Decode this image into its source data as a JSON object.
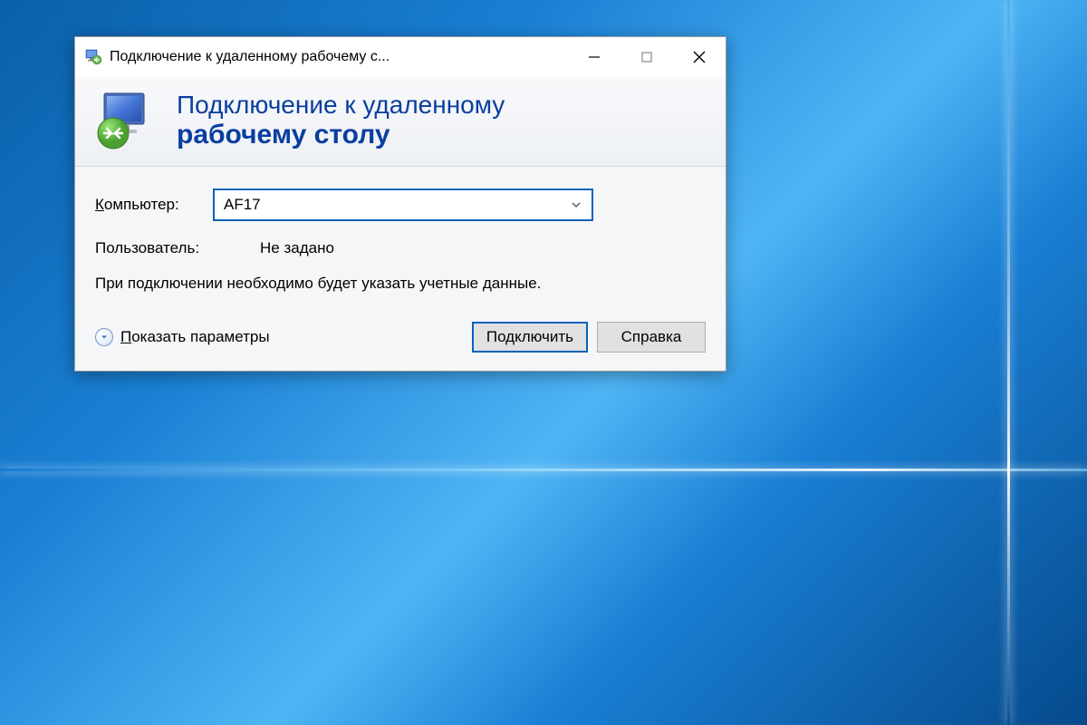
{
  "window": {
    "title": "Подключение к удаленному рабочему с..."
  },
  "banner": {
    "line1": "Подключение к удаленному",
    "line2": "рабочему столу"
  },
  "form": {
    "computer_label": "Компьютер:",
    "computer_value": "AF17",
    "user_label": "Пользователь:",
    "user_value": "Не задано",
    "info_text": "При подключении необходимо будет указать учетные данные."
  },
  "footer": {
    "show_options": "Показать параметры",
    "connect": "Подключить",
    "help": "Справка"
  }
}
